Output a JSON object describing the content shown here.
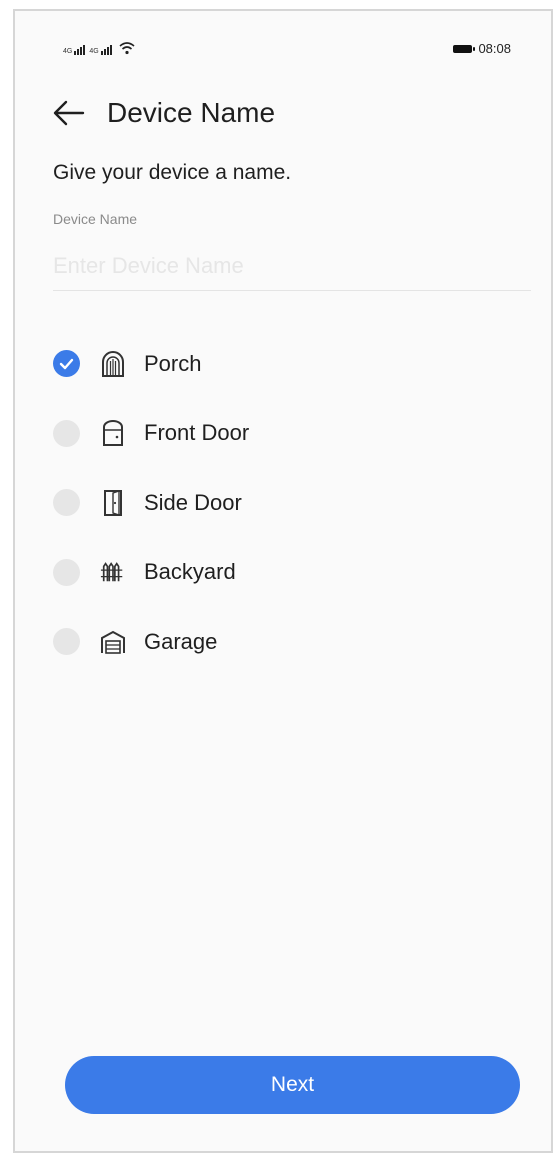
{
  "status_bar": {
    "signal_tag": "4G",
    "time": "08:08",
    "icons": [
      "signal-1-icon",
      "signal-2-icon",
      "wifi-icon",
      "battery-icon"
    ]
  },
  "header": {
    "back_icon": "arrow-left-icon",
    "title": "Device Name"
  },
  "form": {
    "prompt": "Give your device a name.",
    "field_label": "Device Name",
    "input_value": "",
    "input_placeholder": "Enter Device Name"
  },
  "options": [
    {
      "label": "Porch",
      "icon": "porch-arch-icon",
      "selected": true
    },
    {
      "label": "Front Door",
      "icon": "front-door-icon",
      "selected": false
    },
    {
      "label": "Side Door",
      "icon": "side-door-icon",
      "selected": false
    },
    {
      "label": "Backyard",
      "icon": "fence-icon",
      "selected": false
    },
    {
      "label": "Garage",
      "icon": "garage-icon",
      "selected": false
    }
  ],
  "footer": {
    "next_label": "Next"
  },
  "colors": {
    "accent": "#3b7be8",
    "radio_unselected": "#e6e6e6",
    "text": "#1f1f1f",
    "muted": "#8a8a8a",
    "placeholder": "#e6e6e6"
  }
}
